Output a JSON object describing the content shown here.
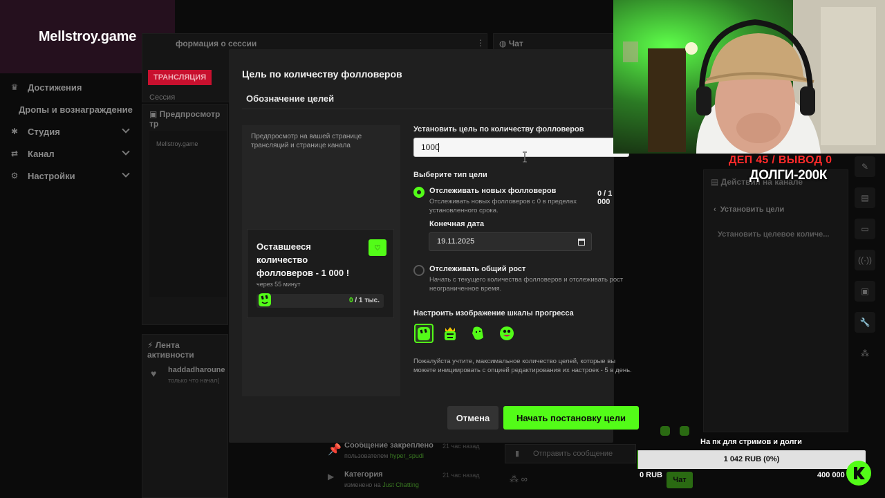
{
  "overlay": {
    "brand": "Mellstroy.game",
    "dep_line": "ДЕП 45 / ВЫВОД 0",
    "debts_line": "ДОЛГИ-200К",
    "donation": {
      "title": "На пк для стримов и долги",
      "current": "1 042 RUB (0%)",
      "min": "0 RUB",
      "max": "400 000 RUB",
      "progress_fraction": 0.0026
    }
  },
  "sidebar": {
    "items": [
      {
        "label": "Достижения",
        "icon": "trophy-icon"
      },
      {
        "label": "Дропы и вознаграждение",
        "icon": ""
      },
      {
        "label": "Студия",
        "icon": "studio-icon"
      },
      {
        "label": "Канал",
        "icon": "channel-icon"
      },
      {
        "label": "Настройки",
        "icon": "gear-icon"
      }
    ]
  },
  "background": {
    "session_panel_title": "формация о сессии",
    "live_badge": "ТРАНСЛЯЦИЯ",
    "session_label": "Сессия",
    "preview_title": "Предпросмотр тр",
    "preview_channel": "Mellstroy.game",
    "chat_title": "Чат",
    "activity_title": "Лента активности",
    "activity_user": "haddadharoune",
    "activity_sub": "только что начал(",
    "pinned_title": "Сообщение закреплено",
    "pinned_by_prefix": "пользователем",
    "pinned_by_user": "hyper_spudi",
    "category_title": "Категория",
    "category_prefix": "изменено на",
    "category_value": "Just Chatting",
    "time_ago_1": "21 час назад",
    "time_ago_2": "21 час назад",
    "send_placeholder": "Отправить сообщение",
    "chat_button": "Чат",
    "actions_title": "Действия на канале",
    "actions_back": "Установить цели",
    "actions_item": "Установить целевое количе..."
  },
  "modal": {
    "title": "Цель по количеству фолловеров",
    "subtitle": "Обозначение целей",
    "preview_text": "Предпросмотр на вашей странице трансляций и странице канала",
    "goal_card": {
      "title": "Оставшееся количество фолловеров - 1 000 !",
      "time": "через 55 минут",
      "count_current": "0",
      "count_total": " / 1 тыс."
    },
    "target_label": "Установить цель по количеству фолловеров",
    "target_value": "1000",
    "type_label": "Выберите тип цели",
    "option_new": {
      "label": "Отслеживать новых фолловеров",
      "desc": "Отслеживать новых фолловеров с 0 в пределах установленного срока.",
      "ratio": "0 / 1 000"
    },
    "end_date_label": "Конечная дата",
    "end_date_value": "19.11.2025",
    "option_total": {
      "label": "Отслеживать общий рост",
      "desc": "Начать с текущего количества фолловеров и отслеживать рост неограниченное время."
    },
    "skin_label": "Настроить изображение шкалы прогресса",
    "note": "Пожалуйста учтите, максимальное количество целей, которые вы можете инициировать с опцией редактирования их настроек - 5 в день.",
    "cancel_label": "Отмена",
    "start_label": "Начать постановку цели"
  },
  "colors": {
    "accent": "#53fc18",
    "modal_bg": "#1f1f1f",
    "danger": "#ff2a2a",
    "watermark_bg": "#25101e"
  }
}
